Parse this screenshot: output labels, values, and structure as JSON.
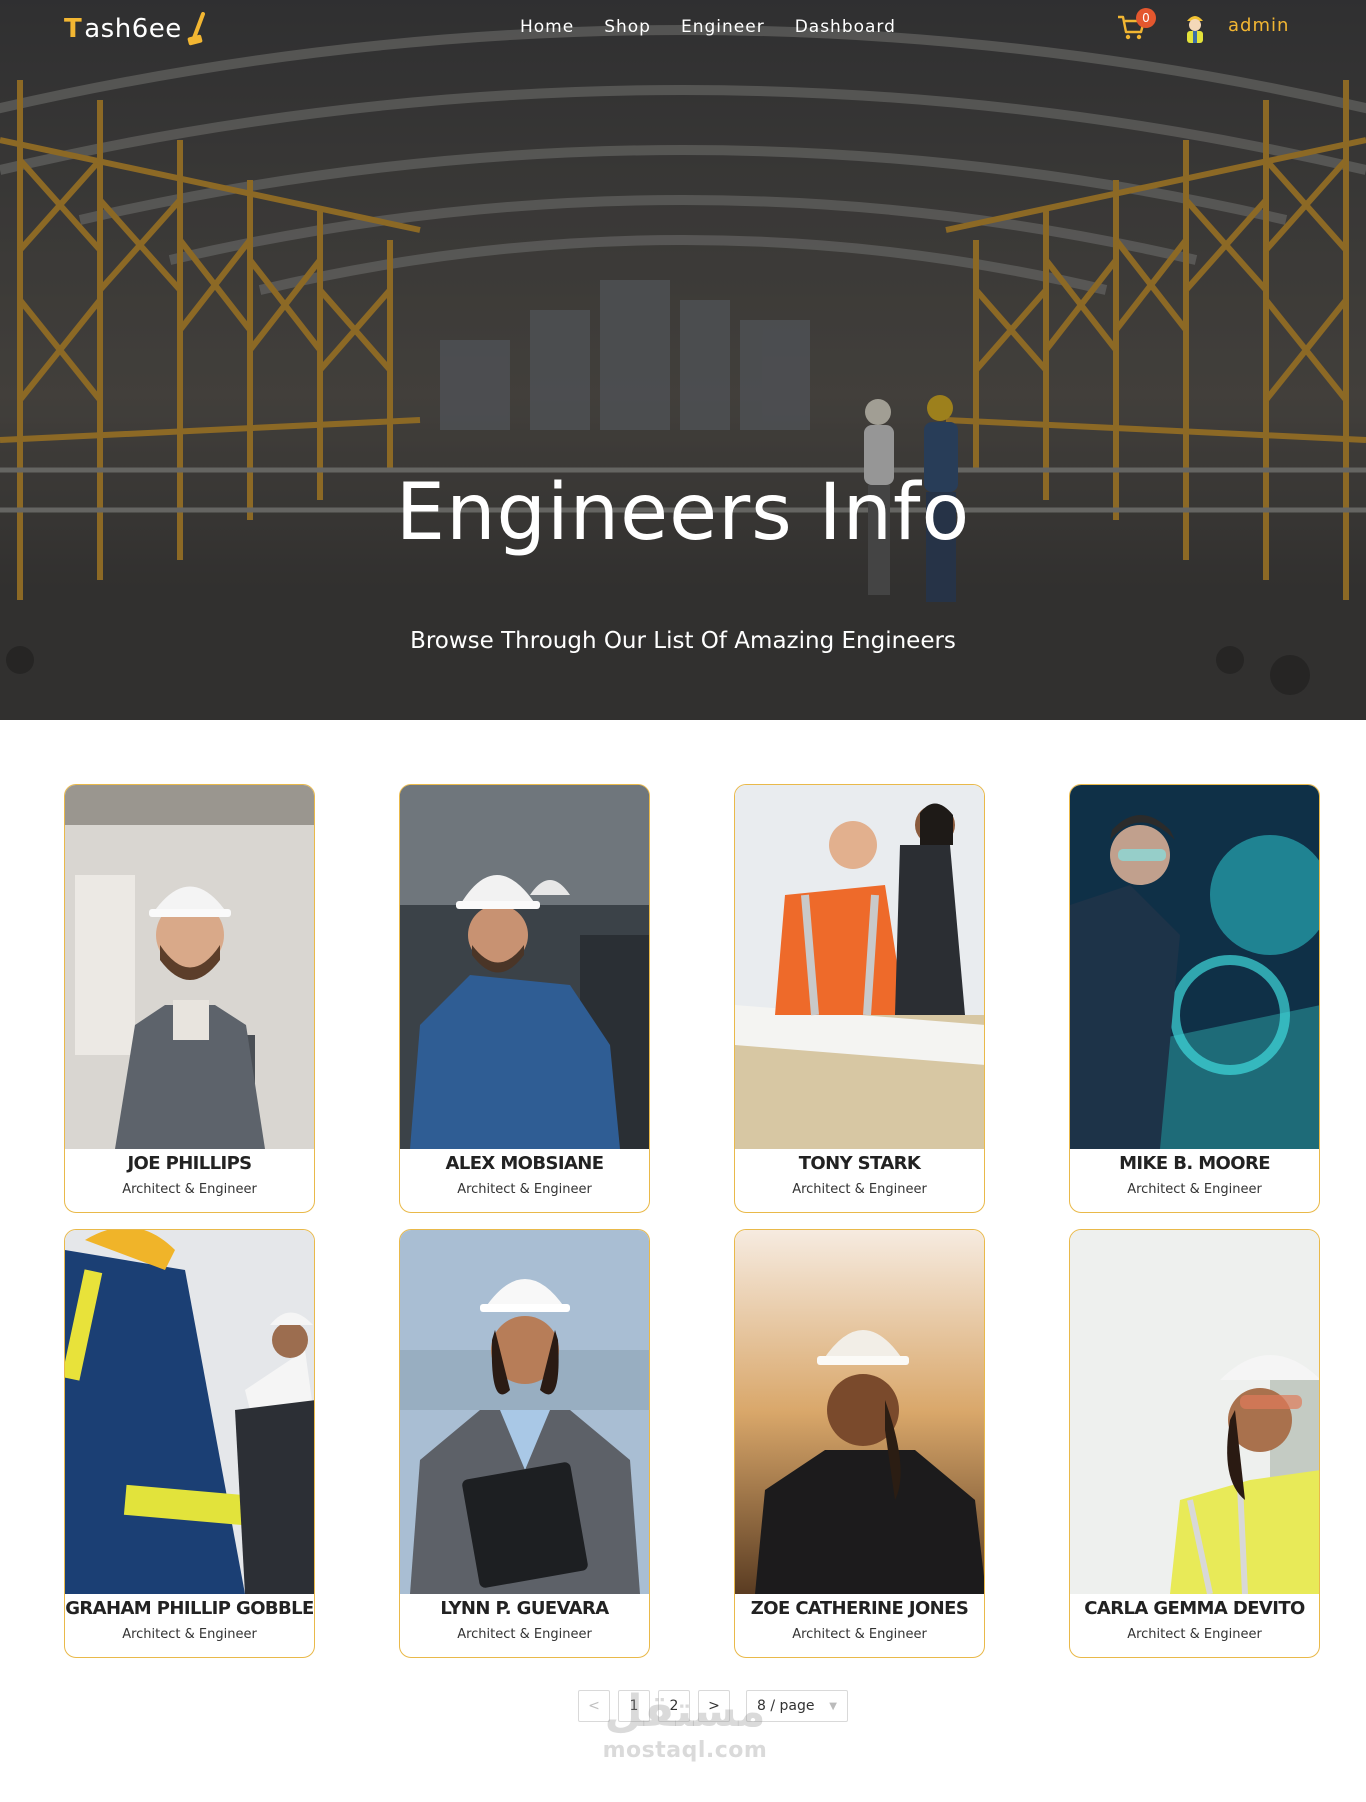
{
  "brand": {
    "name_first": "T",
    "name_rest": "ash6ee"
  },
  "nav": {
    "items": [
      {
        "label": "Home"
      },
      {
        "label": "Shop"
      },
      {
        "label": "Engineer"
      },
      {
        "label": "Dashboard"
      }
    ],
    "cart_count": "0",
    "user_name": "admin"
  },
  "hero": {
    "title": "Engineers Info",
    "subtitle": "Browse Through Our List Of Amazing Engineers"
  },
  "engineers": [
    {
      "name": "JOE PHILLIPS",
      "role": "Architect & Engineer"
    },
    {
      "name": "ALEX MOBSIANE",
      "role": "Architect & Engineer"
    },
    {
      "name": "TONY STARK",
      "role": "Architect & Engineer"
    },
    {
      "name": "MIKE B. MOORE",
      "role": "Architect & Engineer"
    },
    {
      "name": "GRAHAM PHILLIP GOBBLE",
      "role": "Architect & Engineer"
    },
    {
      "name": "LYNN P. GUEVARA",
      "role": "Architect & Engineer"
    },
    {
      "name": "ZOE CATHERINE JONES",
      "role": "Architect & Engineer"
    },
    {
      "name": "CARLA GEMMA DEVITO",
      "role": "Architect & Engineer"
    }
  ],
  "pagination": {
    "prev": "<",
    "pages": [
      "1",
      "2"
    ],
    "next": ">",
    "page_size": "8 / page"
  },
  "watermark": {
    "arabic": "مستقل",
    "latin": "mostaql.com"
  },
  "colors": {
    "accent": "#f2b632",
    "card_border": "#e9b94a",
    "badge": "#e4572e"
  }
}
